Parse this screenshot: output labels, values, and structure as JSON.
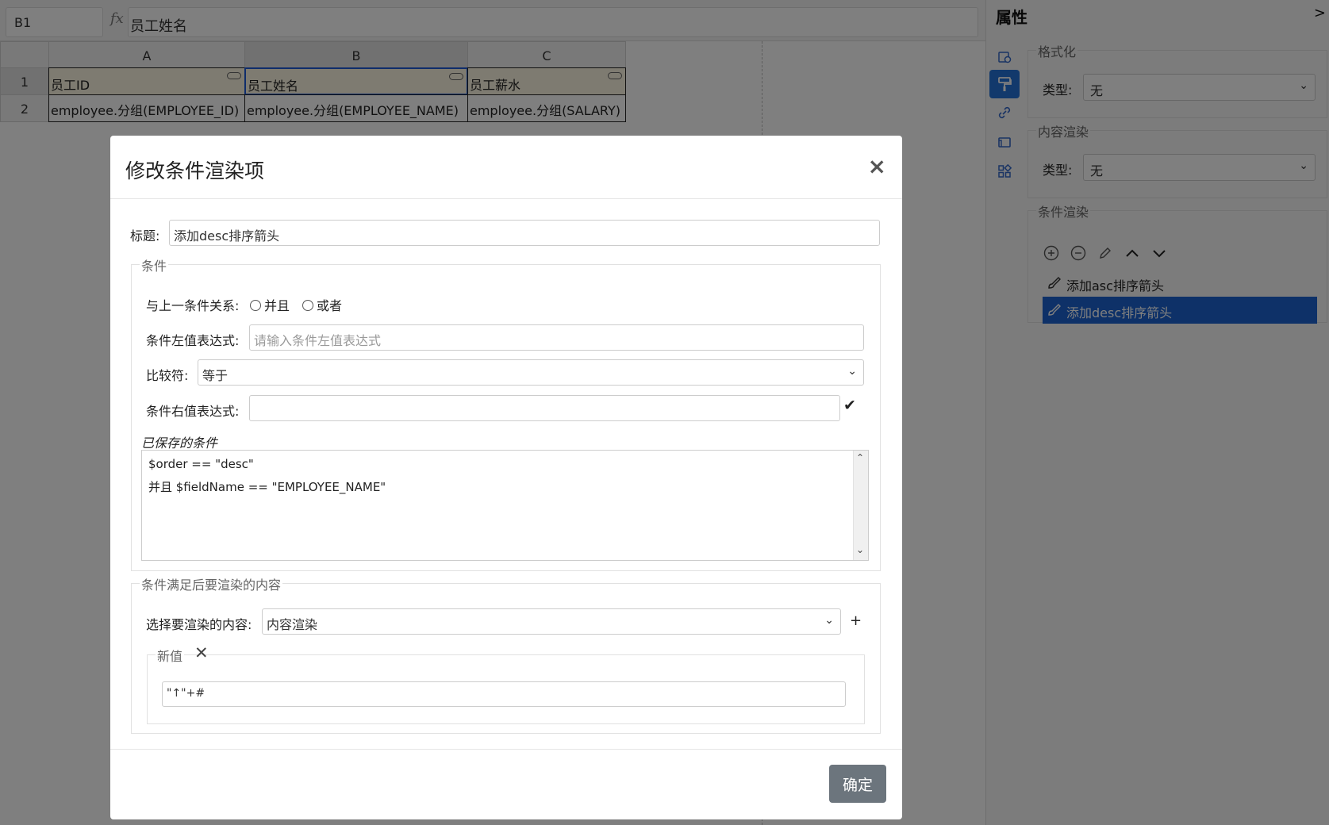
{
  "formula_bar": {
    "cell_ref": "B1",
    "fx": "fx",
    "value": "员工姓名"
  },
  "grid": {
    "columns": [
      "A",
      "B",
      "C"
    ],
    "rows": [
      "1",
      "2"
    ],
    "cells": [
      [
        "员工ID",
        "员工姓名",
        "员工薪水"
      ],
      [
        "employee.分组(EMPLOYEE_ID)",
        "employee.分组(EMPLOYEE_NAME)",
        "employee.分组(SALARY)"
      ]
    ]
  },
  "panel": {
    "title": "属性",
    "toggle": ">",
    "side_icons": [
      "cell-property-icon",
      "format-brush-icon",
      "link-icon",
      "frame-icon",
      "grid-apps-icon"
    ],
    "format": {
      "legend": "格式化",
      "type_label": "类型:",
      "type_value": "无"
    },
    "content_render": {
      "legend": "内容渲染",
      "type_label": "类型:",
      "type_value": "无"
    },
    "conditional_render": {
      "legend": "条件渲染",
      "tools": [
        "add-circle-icon",
        "remove-circle-icon",
        "edit-icon",
        "move-up-icon",
        "move-down-icon"
      ],
      "items": [
        "添加asc排序箭头",
        "添加desc排序箭头"
      ],
      "selected_index": 1
    }
  },
  "modal": {
    "title": "修改条件渲染项",
    "close": "×",
    "title_label": "标题:",
    "title_value": "添加desc排序箭头",
    "condition": {
      "legend": "条件",
      "relation_label": "与上一条件关系:",
      "relation_options": [
        "并且",
        "或者"
      ],
      "left_label": "条件左值表达式:",
      "left_placeholder": "请输入条件左值表达式",
      "op_label": "比较符:",
      "op_value": "等于",
      "right_label": "条件右值表达式:",
      "right_value": "",
      "confirm_icon": "✔",
      "saved_label": "已保存的条件",
      "saved_lines": [
        "$order == \"desc\"",
        "并且 $fieldName == \"EMPLOYEE_NAME\""
      ]
    },
    "render": {
      "legend": "条件满足后要渲染的内容",
      "select_label": "选择要渲染的内容:",
      "select_value": "内容渲染",
      "add_icon": "+",
      "new_value_legend": "新值",
      "remove_icon": "✕",
      "new_value": "\"↑\"+#"
    },
    "ok_label": "确定"
  }
}
